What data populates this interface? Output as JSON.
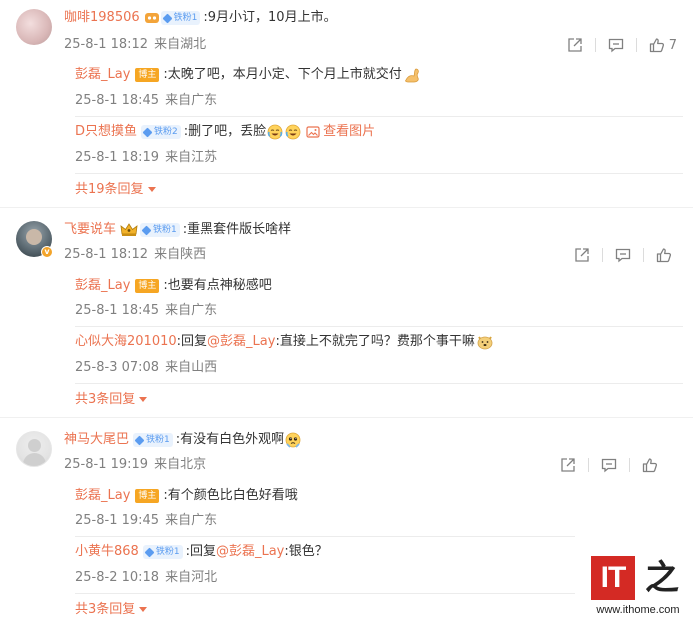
{
  "comments": [
    {
      "user": "咖啡198506",
      "fan_badge": "铁粉1",
      "text": ":9月小订，10月上市。",
      "date": "25-8-1 18:12",
      "location": "来自湖北",
      "like_count": "7",
      "replies": [
        {
          "user": "彭磊_Lay",
          "host_badge": "博主",
          "text": ":太晚了吧，本月小定、下个月上市就交付",
          "emoji": "flexed-biceps-emoji",
          "date": "25-8-1 18:45",
          "location": "来自广东"
        },
        {
          "user": "D只想摸鱼",
          "fan_badge": "铁粉2",
          "text": ":删了吧，丢脸",
          "emoji": "crying-laughing-emoji",
          "pic_link": "查看图片",
          "date": "25-8-1 18:19",
          "location": "来自江苏"
        }
      ],
      "more_replies": "共19条回复"
    },
    {
      "user": "飞要说车",
      "fan_badge": "铁粉1",
      "text": ":重黑套件版长啥样",
      "date": "25-8-1 18:12",
      "location": "来自陕西",
      "like_count": "",
      "replies": [
        {
          "user": "彭磊_Lay",
          "host_badge": "博主",
          "text": ":也要有点神秘感吧",
          "date": "25-8-1 18:45",
          "location": "来自广东"
        },
        {
          "user": "心似大海201010",
          "text_prefix": ":回复",
          "mention": "@彭磊_Lay",
          "text": ":直接上不就完了吗？费那个事干嘛",
          "emoji": "doge-emoji",
          "date": "25-8-3 07:08",
          "location": "来自山西"
        }
      ],
      "more_replies": "共3条回复"
    },
    {
      "user": "神马大尾巴",
      "fan_badge": "铁粉1",
      "text": ":有没有白色外观啊",
      "emoji": "pleading-emoji",
      "date": "25-8-1 19:19",
      "location": "来自北京",
      "like_count": "",
      "replies": [
        {
          "user": "彭磊_Lay",
          "host_badge": "博主",
          "text": ":有个颜色比白色好看哦",
          "date": "25-8-1 19:45",
          "location": "来自广东"
        },
        {
          "user": "小黄牛868",
          "fan_badge": "铁粉1",
          "text_prefix": ":回复",
          "mention": "@彭磊_Lay",
          "text": ":银色？",
          "date": "25-8-2 10:18",
          "location": "来自河北"
        }
      ],
      "more_replies": "共3条回复"
    }
  ],
  "watermark": {
    "logo_text": "IT",
    "logo_char": "之",
    "url": "www.ithome.com"
  },
  "colors": {
    "username": "#eb7350",
    "text": "#333333",
    "meta": "#808080",
    "fan_badge": "#5b9cf0",
    "host_badge": "#f6a623",
    "watermark_red": "#d42a24"
  }
}
